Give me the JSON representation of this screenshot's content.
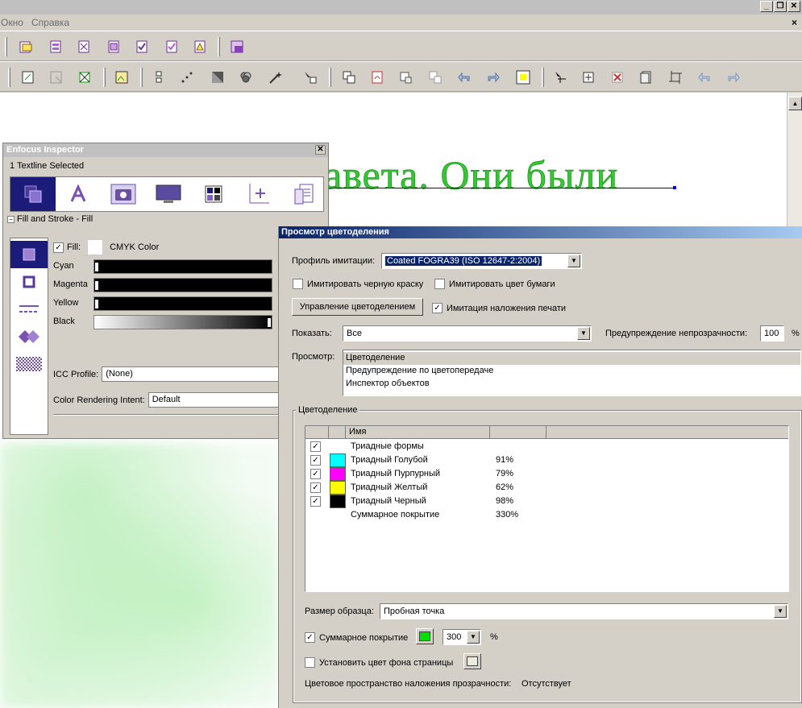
{
  "menubar": {
    "items": [
      "Окно",
      "Справка"
    ],
    "close_glyph": "×"
  },
  "window_buttons": {
    "minimize": "_",
    "restore": "❐",
    "close": "✕"
  },
  "document": {
    "visible_text": "авета. Они были"
  },
  "inspector": {
    "title": "Enfocus Inspector",
    "selection": "1 Textline Selected",
    "section": "Fill and Stroke - Fill",
    "fill_label": "Fill:",
    "fill_checked": true,
    "color_model": "CMYK Color",
    "channels": [
      {
        "name": "Cyan",
        "value": 0
      },
      {
        "name": "Magenta",
        "value": 0
      },
      {
        "name": "Yellow",
        "value": 0
      },
      {
        "name": "Black",
        "value": 100
      }
    ],
    "icc_label": "ICC Profile:",
    "icc_value": "(None)",
    "intent_label": "Color Rendering Intent:",
    "intent_value": "Default"
  },
  "separation_preview": {
    "title": "Просмотр цветоделения",
    "profile_label": "Профиль имитации:",
    "profile_value": "Coated FOGRA39 (ISO 12647-2:2004)",
    "simulate_black_ink": {
      "label": "Имитировать черную краску",
      "checked": false
    },
    "simulate_paper_color": {
      "label": "Имитировать цвет бумаги",
      "checked": false
    },
    "ink_manager_button": "Управление цветоделением",
    "simulate_overprint": {
      "label": "Имитация наложения печати",
      "checked": true
    },
    "show_label": "Показать:",
    "show_value": "Все",
    "opacity_warning_label": "Предупреждение непрозрачности:",
    "opacity_warning_value": "100",
    "opacity_unit": "%",
    "preview_label": "Просмотр:",
    "preview_options": [
      "Цветоделение",
      "Предупреждение по цветопередаче",
      "Инспектор объектов"
    ],
    "preview_selected": 0,
    "group_label": "Цветоделение",
    "table_header_name": "Имя",
    "inks": [
      {
        "checked": true,
        "name": "Триадные формы",
        "color": "",
        "coverage": ""
      },
      {
        "checked": true,
        "name": "Триадный Голубой",
        "color": "#00ffff",
        "coverage": "91%"
      },
      {
        "checked": true,
        "name": "Триадный Пурпурный",
        "color": "#ff00ff",
        "coverage": "79%"
      },
      {
        "checked": true,
        "name": "Триадный Желтый",
        "color": "#ffff00",
        "coverage": "62%"
      },
      {
        "checked": true,
        "name": "Триадный Черный",
        "color": "#000000",
        "coverage": "98%"
      },
      {
        "checked": null,
        "name": "Суммарное покрытие",
        "color": "",
        "coverage": "330%"
      }
    ],
    "sample_size_label": "Размер образца:",
    "sample_size_value": "Пробная точка",
    "total_coverage": {
      "label": "Суммарное покрытие",
      "checked": true,
      "color": "#00e000",
      "value": "300",
      "unit": "%"
    },
    "page_bg": {
      "label": "Установить цвет фона страницы",
      "checked": false,
      "color": "#ecebe0"
    },
    "blend_space_label": "Цветовое пространство наложения прозрачности:",
    "blend_space_value": "Отсутствует"
  },
  "checkmark": "✓"
}
